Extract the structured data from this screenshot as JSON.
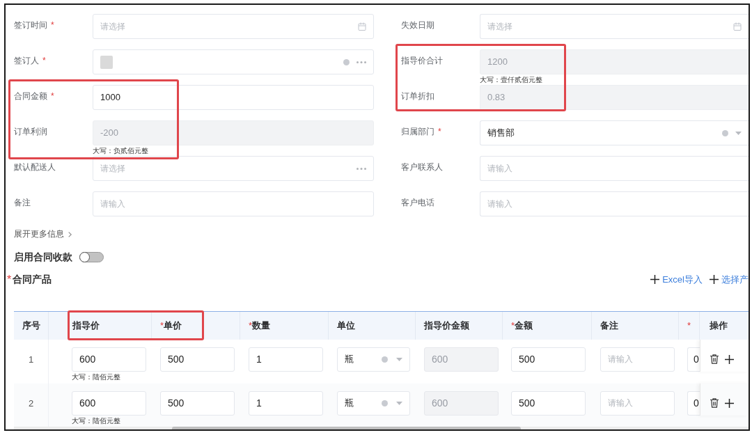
{
  "form": {
    "left": [
      {
        "label": "签订时间",
        "required_mark": "*",
        "kind": "date",
        "placeholder": "请选择",
        "disabled": false,
        "clearable": false,
        "highlighted": false
      },
      {
        "label": "签订人",
        "required_mark": "*",
        "kind": "picker",
        "redacted": true,
        "disabled": false,
        "clearable": true,
        "highlighted": false
      },
      {
        "label": "合同金额",
        "required_mark": "*",
        "kind": "text",
        "value": "1000",
        "disabled": false,
        "clearable": false,
        "highlighted": true
      },
      {
        "label": "订单利润",
        "kind": "text",
        "value": "-200",
        "hint": "大写：负贰佰元整",
        "disabled": true,
        "clearable": false,
        "highlighted": true
      },
      {
        "label": "默认配送人",
        "kind": "picker",
        "placeholder": "请选择",
        "disabled": false,
        "clearable": false,
        "highlighted": false
      },
      {
        "label": "备注",
        "kind": "text",
        "placeholder": "请输入",
        "disabled": false,
        "clearable": false,
        "highlighted": false
      }
    ],
    "right": [
      {
        "label": "失效日期",
        "kind": "date",
        "placeholder": "请选择",
        "disabled": false,
        "clearable": false,
        "highlighted": false
      },
      {
        "label": "指导价合计",
        "kind": "text",
        "value": "1200",
        "hint": "大写：壹仟贰佰元整",
        "disabled": true,
        "clearable": false,
        "highlighted": true
      },
      {
        "label": "订单折扣",
        "kind": "text",
        "value": "0.83",
        "disabled": true,
        "clearable": false,
        "highlighted": true
      },
      {
        "label": "归属部门",
        "required_mark": "*",
        "kind": "select",
        "value": "销售部",
        "disabled": false,
        "clearable": true,
        "highlighted": false
      },
      {
        "label": "客户联系人",
        "kind": "text",
        "placeholder": "请输入",
        "disabled": false,
        "clearable": false,
        "highlighted": false
      },
      {
        "label": "客户电话",
        "kind": "text",
        "placeholder": "请输入",
        "disabled": false,
        "clearable": false,
        "highlighted": false
      }
    ]
  },
  "expand_link": {
    "label": "展开更多信息"
  },
  "contract_payment": {
    "label": "启用合同收款",
    "on": false
  },
  "products": {
    "required_mark": "*",
    "title": "合同产品",
    "actions": [
      {
        "label": "Excel导入"
      },
      {
        "label": "选择产"
      }
    ]
  },
  "table": {
    "columns": [
      {
        "label": "序号",
        "highlighted": false
      },
      {
        "label": "指导价",
        "highlighted": true
      },
      {
        "required_mark": "*",
        "label": "单价",
        "highlighted": true
      },
      {
        "required_mark": "*",
        "label": "数量",
        "highlighted": false
      },
      {
        "label": "单位",
        "highlighted": false
      },
      {
        "label": "指导价金额",
        "highlighted": false
      },
      {
        "required_mark": "*",
        "label": "金额",
        "highlighted": false
      },
      {
        "label": "备注",
        "highlighted": false
      },
      {
        "required_mark": "*",
        "highlighted": false
      },
      {
        "label": "操作",
        "highlighted": false
      }
    ],
    "rows": [
      {
        "cells": [
          {
            "kind": "index",
            "value": "1"
          },
          {
            "kind": "input",
            "value": "600",
            "hint": "大写：陆佰元整",
            "disabled": false
          },
          {
            "kind": "input",
            "value": "500",
            "disabled": false
          },
          {
            "kind": "input",
            "value": "1",
            "disabled": false
          },
          {
            "kind": "select",
            "value": "瓶",
            "disabled": false,
            "clearable": true
          },
          {
            "kind": "input",
            "value": "600",
            "disabled": true
          },
          {
            "kind": "input",
            "value": "500",
            "disabled": false
          },
          {
            "kind": "input",
            "placeholder": "请输入",
            "disabled": false
          },
          {
            "kind": "input",
            "value": "0",
            "disabled": false
          },
          {
            "kind": "actions"
          }
        ]
      },
      {
        "cells": [
          {
            "kind": "index",
            "value": "2"
          },
          {
            "kind": "input",
            "value": "600",
            "hint": "大写：陆佰元整",
            "disabled": false
          },
          {
            "kind": "input",
            "value": "500",
            "disabled": false
          },
          {
            "kind": "input",
            "value": "1",
            "disabled": false
          },
          {
            "kind": "select",
            "value": "瓶",
            "disabled": false,
            "clearable": true
          },
          {
            "kind": "input",
            "value": "600",
            "disabled": true
          },
          {
            "kind": "input",
            "value": "500",
            "disabled": false
          },
          {
            "kind": "input",
            "placeholder": "请输入",
            "disabled": false
          },
          {
            "kind": "input",
            "value": "0",
            "disabled": false
          },
          {
            "kind": "actions"
          }
        ]
      }
    ]
  }
}
